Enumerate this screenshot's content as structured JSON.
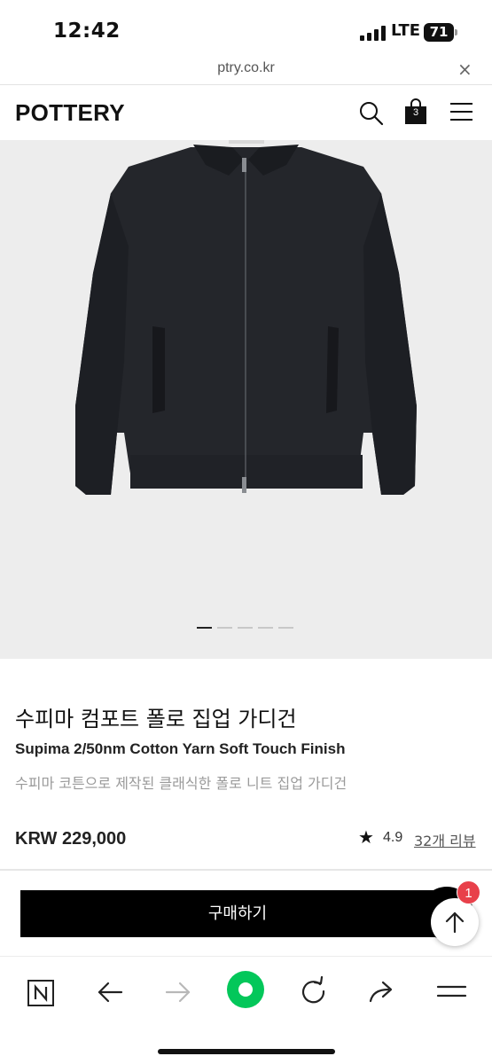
{
  "status_bar": {
    "time": "12:42",
    "network": "LTE",
    "battery": "71"
  },
  "browser": {
    "url": "ptry.co.kr",
    "close_glyph": "×"
  },
  "header": {
    "logo": "POTTERY",
    "cart_count": "3",
    "icons": [
      "search-icon",
      "shopping-bag-icon",
      "hamburger-menu-icon"
    ]
  },
  "gallery": {
    "image": "black zip-up collared knit cardigan on light gray background",
    "slides": 5,
    "active_slide": 1
  },
  "product": {
    "title": "수피마 컴포트 폴로 집업 가디건",
    "subtitle": "Supima 2/50nm Cotton Yarn Soft Touch Finish",
    "description": "수피마 코튼으로 제작된 클래식한 폴로 니트 집업 가디건",
    "price": "KRW 229,000",
    "rating_star": "★",
    "rating": "4.9",
    "review_link": "32개 리뷰"
  },
  "actions": {
    "buy_label": "구매하기",
    "notification_count": "1"
  },
  "toolbar": {
    "items": [
      "naver-home-icon",
      "back-arrow-icon",
      "forward-arrow-icon",
      "green-dot-icon",
      "reload-icon",
      "share-icon",
      "menu-icon"
    ]
  },
  "colors": {
    "accent_green": "#03c75a",
    "badge_red": "#e8404a",
    "button_black": "#000000",
    "image_bg": "#ededed"
  }
}
